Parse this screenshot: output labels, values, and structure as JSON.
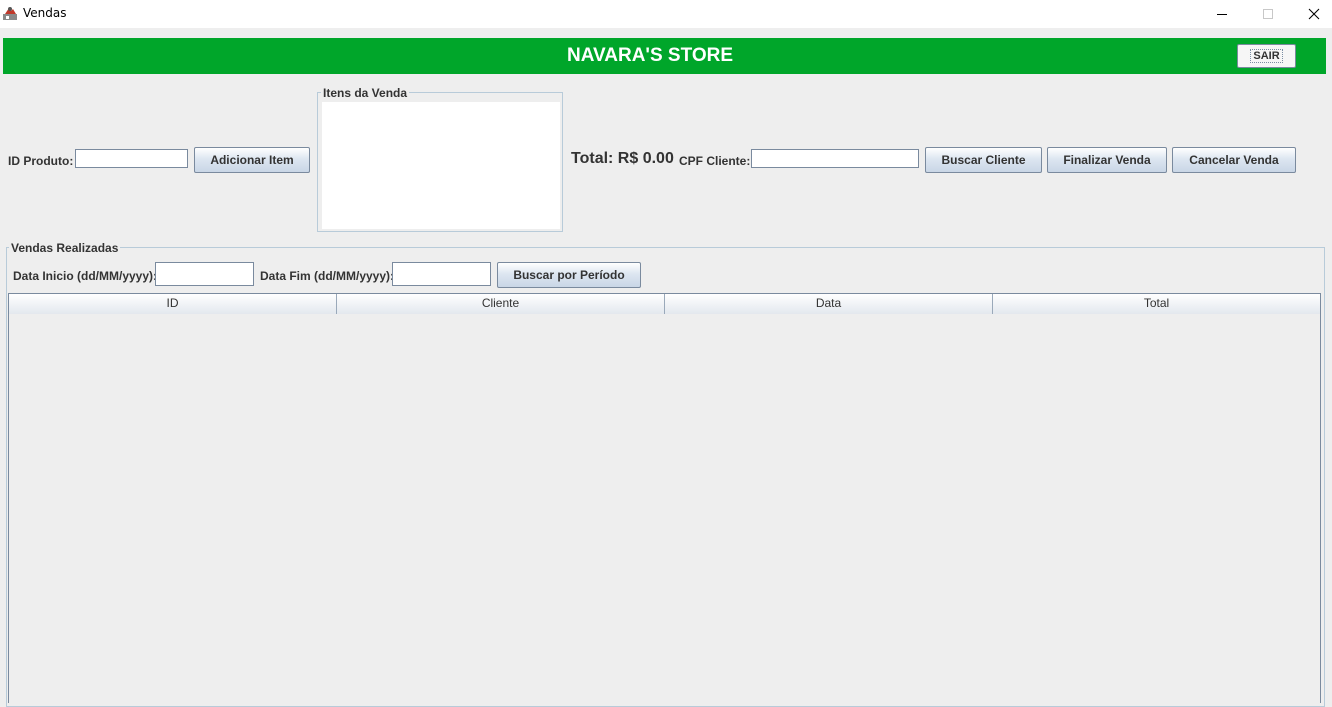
{
  "window": {
    "title": "Vendas",
    "icon": "java-app-icon",
    "minimize_icon": "minimize-icon",
    "maximize_icon": "maximize-icon",
    "close_icon": "close-icon"
  },
  "banner": {
    "title": "NAVARA'S STORE",
    "color": "#00a62a",
    "exit_label": "SAIR"
  },
  "sale": {
    "product_id_label": "ID Produto:",
    "product_id_value": "",
    "add_item_label": "Adicionar Item",
    "items_title": "Itens da Venda",
    "items": [],
    "total_label": "Total: R$ 0.00",
    "cpf_label": "CPF Cliente:",
    "cpf_value": "",
    "search_client_label": "Buscar Cliente",
    "finish_label": "Finalizar Venda",
    "cancel_label": "Cancelar Venda"
  },
  "history": {
    "title": "Vendas Realizadas",
    "start_label": "Data Inicio (dd/MM/yyyy):",
    "start_value": "",
    "end_label": "Data Fim (dd/MM/yyyy):",
    "end_value": "",
    "search_label": "Buscar por Período",
    "columns": [
      "ID",
      "Cliente",
      "Data",
      "Total"
    ],
    "rows": []
  }
}
